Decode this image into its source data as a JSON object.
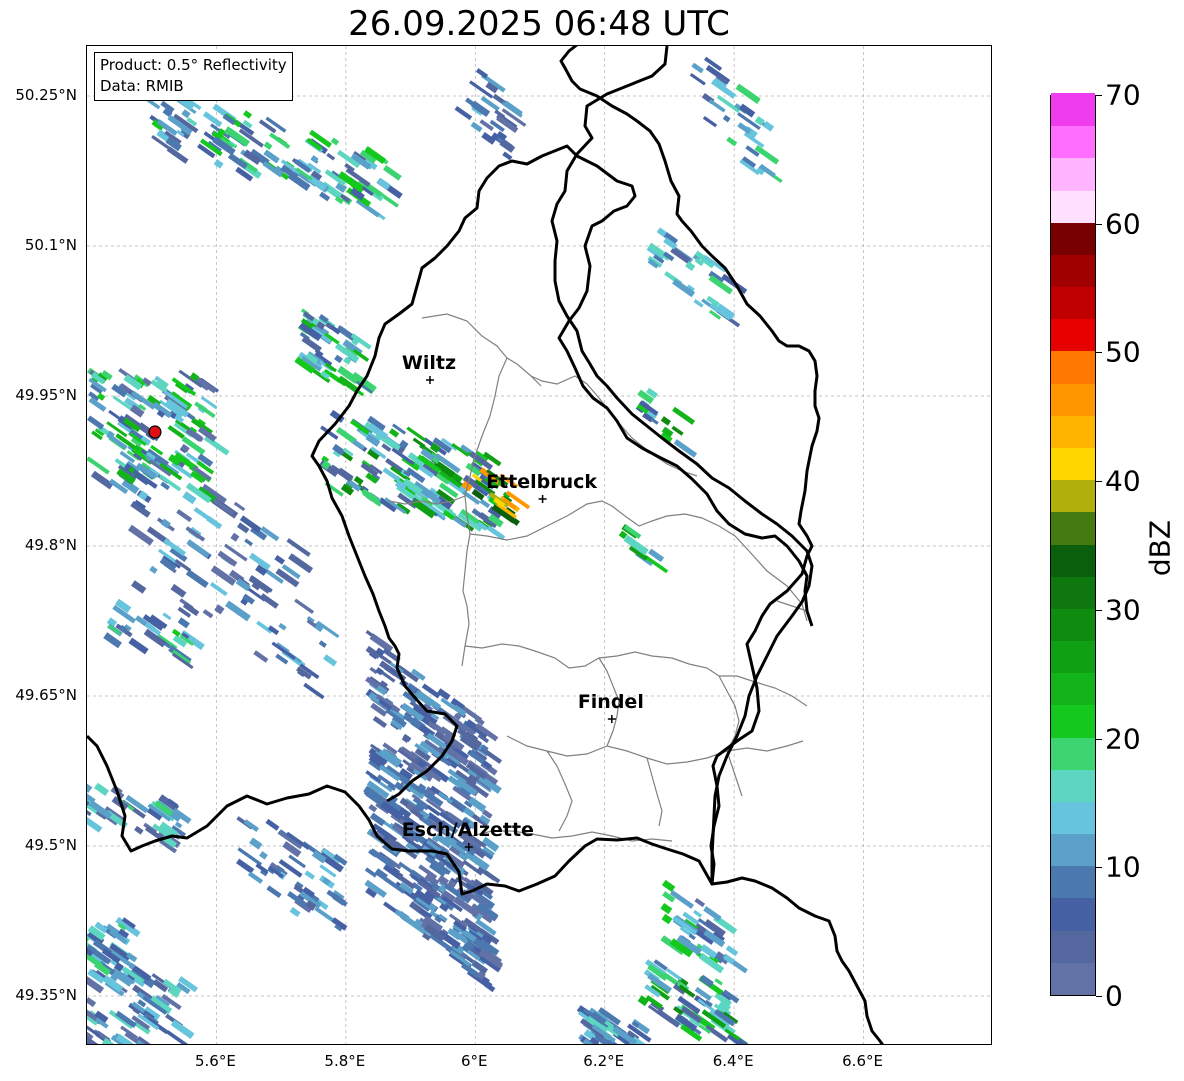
{
  "title": "26.09.2025 06:48 UTC",
  "info": {
    "product": "Product: 0.5° Reflectivity",
    "data_source": "Data: RMIB"
  },
  "axes": {
    "lat_ticks": [
      "50.25°N",
      "50.1°N",
      "49.95°N",
      "49.8°N",
      "49.65°N",
      "49.5°N",
      "49.35°N"
    ],
    "lon_ticks": [
      "5.6°E",
      "5.8°E",
      "6°E",
      "6.2°E",
      "6.4°E",
      "6.6°E"
    ],
    "lat_values": [
      50.25,
      50.1,
      49.95,
      49.8,
      49.65,
      49.5,
      49.35
    ],
    "lon_values": [
      5.6,
      5.8,
      6.0,
      6.2,
      6.4,
      6.6
    ],
    "lon_range": [
      5.4,
      6.8
    ],
    "lat_range": [
      49.3,
      50.3
    ]
  },
  "cities": [
    {
      "name": "Wiltz",
      "lon": 5.93,
      "lat": 49.966
    },
    {
      "name": "Ettelbruck",
      "lon": 6.104,
      "lat": 49.847
    },
    {
      "name": "Findel",
      "lon": 6.211,
      "lat": 49.627
    },
    {
      "name": "Esch/Alzette",
      "lon": 5.99,
      "lat": 49.499
    }
  ],
  "radar_site": {
    "lon": 5.505,
    "lat": 49.914,
    "color": "#dd1111"
  },
  "colorbar": {
    "label": "dBZ",
    "min": 0,
    "max": 70,
    "ticks": [
      "0",
      "10",
      "20",
      "30",
      "40",
      "50",
      "60",
      "70"
    ],
    "colors": [
      "#6272a6",
      "#54689f",
      "#4560a3",
      "#4c78b0",
      "#5aa0c8",
      "#66c4dc",
      "#5cd6c0",
      "#3cd470",
      "#14c81e",
      "#12b41a",
      "#10a014",
      "#0f8c10",
      "#0e780e",
      "#0a5f0c",
      "#457a10",
      "#b0b00a",
      "#ffd700",
      "#ffb400",
      "#ff9600",
      "#ff7800",
      "#e60000",
      "#c00000",
      "#a00000",
      "#780000",
      "#ffe0ff",
      "#ffb4ff",
      "#ff6eff",
      "#ee3cee"
    ]
  }
}
